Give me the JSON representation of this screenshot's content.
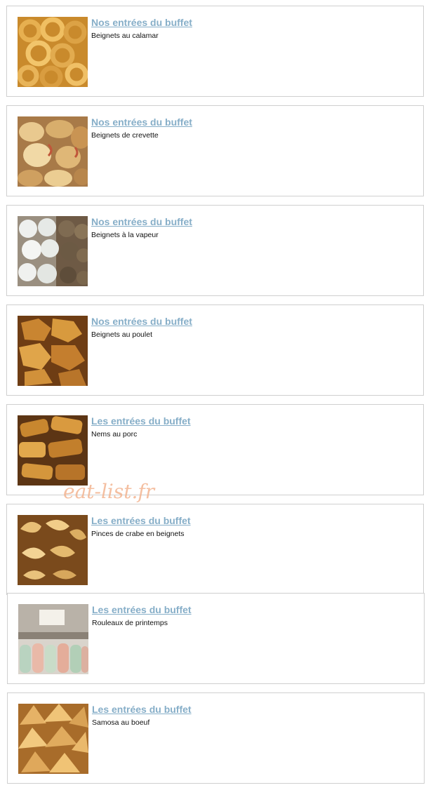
{
  "watermark": "eat-list.fr",
  "colors": {
    "title_link": "#86aec8",
    "card_border": "#cfcfcf",
    "watermark": "#f3b591"
  },
  "items": [
    {
      "title": "Nos entrées du buffet",
      "description": "Beignets au calamar",
      "image": "calamari-rings-photo"
    },
    {
      "title": "Nos entrées du buffet",
      "description": "Beignets de crevette",
      "image": "shrimp-fritters-photo"
    },
    {
      "title": "Nos entrées du buffet",
      "description": "Beignets à la vapeur",
      "image": "steamed-dumplings-photo"
    },
    {
      "title": "Nos entrées du buffet",
      "description": "Beignets au poulet",
      "image": "chicken-fritters-photo"
    },
    {
      "title": "Les entrées du buffet",
      "description": "Nems au porc",
      "image": "pork-spring-rolls-photo"
    },
    {
      "title": "Les entrées du buffet",
      "description": "Pinces de crabe en beignets",
      "image": "crab-claw-fritters-photo"
    },
    {
      "title": "Les entrées du buffet",
      "description": "Rouleaux de printemps",
      "image": "fresh-spring-rolls-photo"
    },
    {
      "title": "Les entrées du buffet",
      "description": "Samosa au boeuf",
      "image": "beef-samosa-photo"
    }
  ]
}
